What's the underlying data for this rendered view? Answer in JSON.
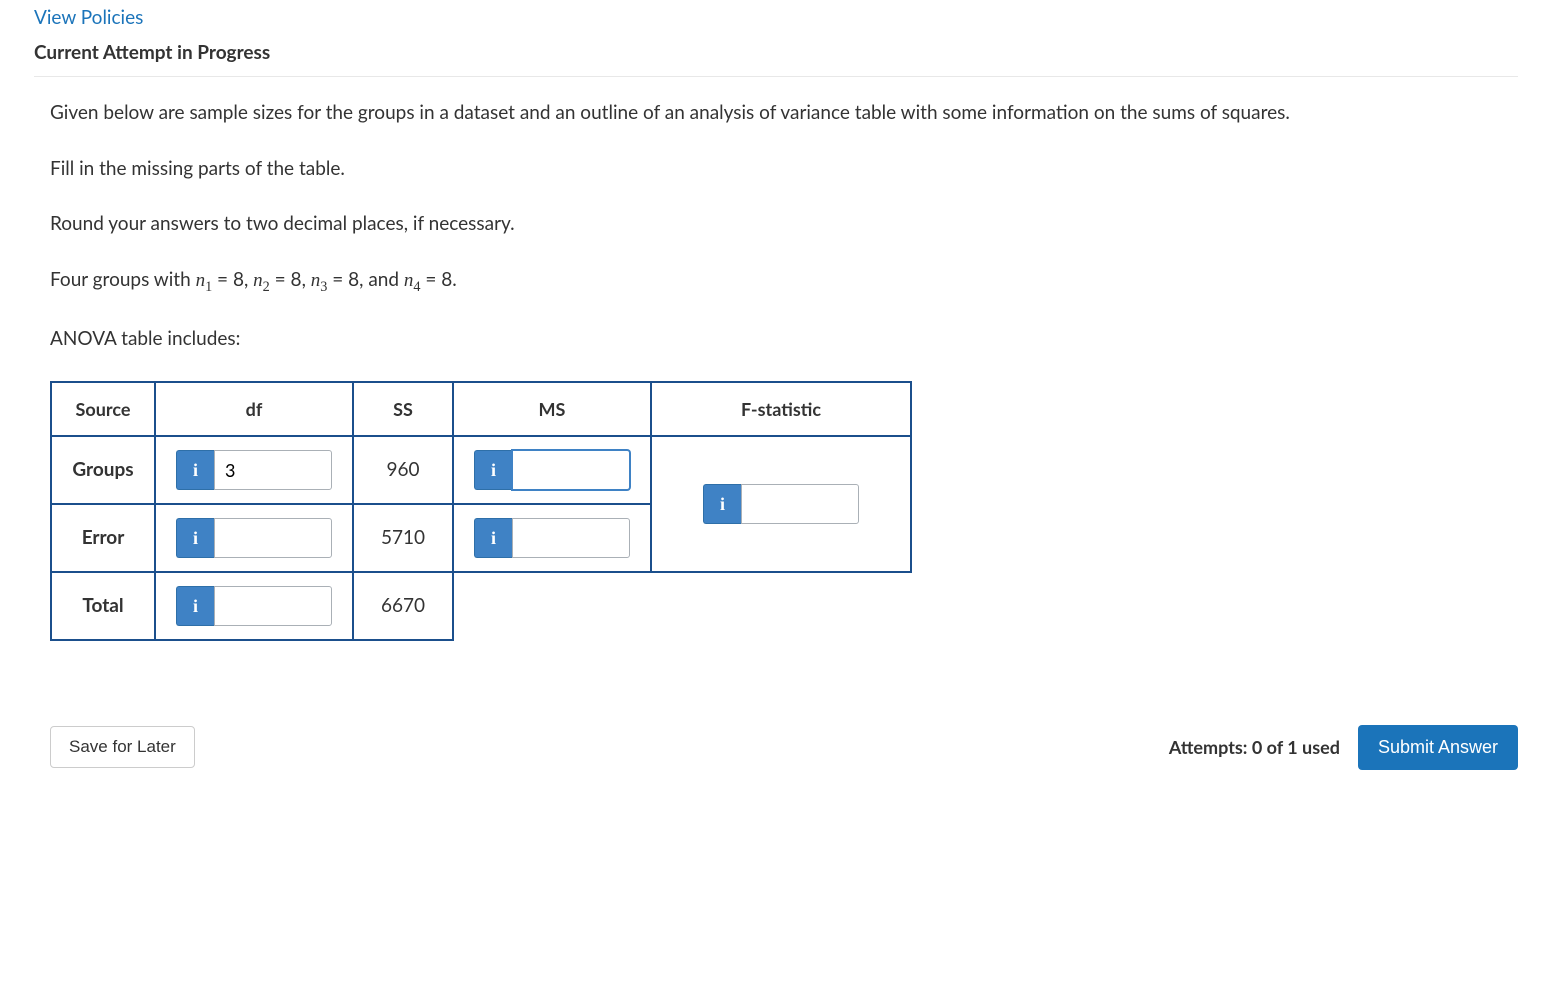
{
  "header": {
    "view_policies": "View Policies",
    "section_title": "Current Attempt in Progress"
  },
  "question": {
    "p1": "Given below are sample sizes for the groups in a dataset and an outline of an analysis of variance table with some information on the sums of squares.",
    "p2": "Fill in the missing parts of the table.",
    "p3": "Round your answers to two decimal places, if necessary.",
    "p4_prefix": "Four groups with ",
    "p4_suffix": ".",
    "p5": "ANOVA table includes:"
  },
  "groups": {
    "n1": "8",
    "n2": "8",
    "n3": "8",
    "n4": "8"
  },
  "table": {
    "headers": {
      "source": "Source",
      "df": "df",
      "ss": "SS",
      "ms": "MS",
      "f": "F-statistic"
    },
    "rows": {
      "groups": {
        "label": "Groups",
        "df_value": "3",
        "ss": "960",
        "ms_value": ""
      },
      "error": {
        "label": "Error",
        "df_value": "",
        "ss": "5710",
        "ms_value": ""
      },
      "total": {
        "label": "Total",
        "df_value": "",
        "ss": "6670"
      },
      "f_value": ""
    }
  },
  "footer": {
    "save": "Save for Later",
    "attempts": "Attempts: 0 of 1 used",
    "submit": "Submit Answer"
  },
  "icons": {
    "info": "i"
  }
}
